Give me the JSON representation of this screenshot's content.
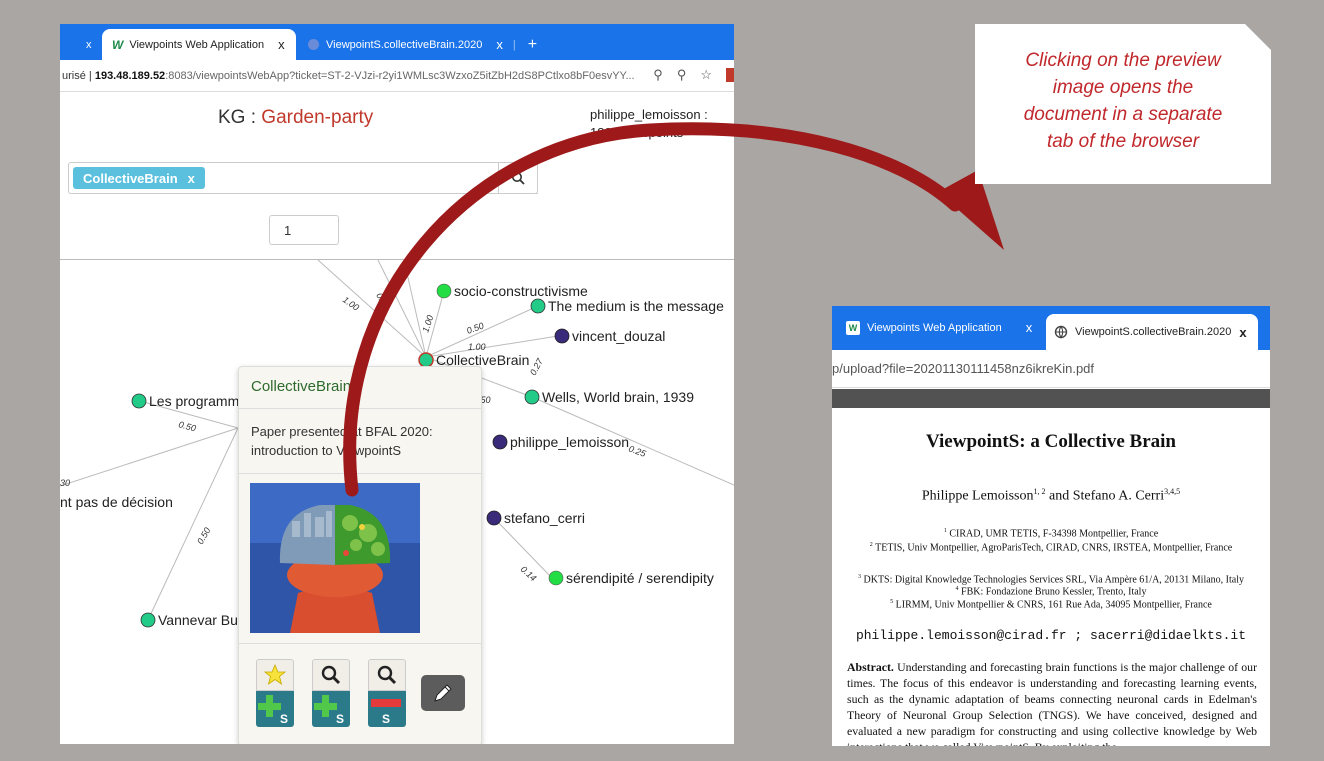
{
  "left_browser": {
    "tabs": [
      {
        "label": "Viewpoints Web Application",
        "close": "x"
      },
      {
        "label": "ViewpointS.collectiveBrain.2020",
        "close": "x"
      }
    ],
    "prev_tab_close": "x",
    "new_tab": "+",
    "address": {
      "prefix": "urisé |",
      "host": "193.48.189.52",
      "path": ":8083/viewpointsWebApp?ticket=ST-2-VJzi-r2yi1WMLsc3WzxoZ5itZbH2dS8PCtlxo8bF0esvYY..."
    },
    "kg_label": "KG :",
    "kg_name": "Garden-party",
    "user_line1": "philippe_lemoisson :",
    "user_line2": "1802 viewpoints",
    "search_tag": "CollectiveBrain",
    "search_tag_remove": "x",
    "page_value": "1"
  },
  "graph": {
    "nodes": [
      {
        "label": "socio-constructivisme",
        "color": "#22dd44"
      },
      {
        "label": "The medium is the message",
        "color": "#22cc88"
      },
      {
        "label": "vincent_douzal",
        "color": "#3a2a7a"
      },
      {
        "label": "CollectiveBrain",
        "color": "#22cc88"
      },
      {
        "label": "Wells, World brain, 1939",
        "color": "#22cc88"
      },
      {
        "label": "philippe_lemoisson",
        "color": "#3a2a7a"
      },
      {
        "label": "stefano_cerri",
        "color": "#3a2a7a"
      },
      {
        "label": "sérendipité / serendipity",
        "color": "#22dd44"
      },
      {
        "label": "Les programm",
        "color": "#22cc88"
      },
      {
        "label": "nt pas de décision",
        "color": ""
      },
      {
        "label": "Vannevar Bu",
        "color": "#22cc88"
      }
    ],
    "edge_labels": [
      "1.00",
      "0.50",
      "1.00",
      "0.50",
      "1.00",
      "0.27",
      ".50",
      "0.25",
      "0.50",
      "0.14",
      "0.50",
      "30"
    ]
  },
  "popup": {
    "title": "CollectiveBrain",
    "desc_line1": "Paper presented at BFAL 2020:",
    "desc_line2": "introduction to ViewpointS",
    "buttons": [
      "add-star",
      "add-zoom",
      "remove-zoom",
      "edit"
    ]
  },
  "callout": {
    "line1": "Clicking on the preview",
    "line2": "image opens the",
    "line3": "document in a separate",
    "line4": "tab of the browser"
  },
  "right_browser": {
    "tab1": "Viewpoints Web Application",
    "tab1_close": "x",
    "tab2": "ViewpointS.collectiveBrain.2020",
    "tab2_close": "x",
    "address": "p/upload?file=20201130111458nz6ikreKin.pdf",
    "pdf": {
      "title": "ViewpointS: a Collective Brain",
      "author1": "Philippe Lemoisson",
      "author1_sup": "1, 2",
      "and": " and ",
      "author2": "Stefano A. Cerri",
      "author2_sup": "3,4,5",
      "aff1": "CIRAD, UMR TETIS, F-34398 Montpellier, France",
      "aff2": "TETIS, Univ Montpellier, AgroParisTech, CIRAD, CNRS, IRSTEA, Montpellier, France",
      "aff3": "DKTS: Digital Knowledge Technologies Services SRL, Via Ampère 61/A, 20131 Milano, Italy",
      "aff4": "FBK: Fondazione Bruno Kessler, Trento, Italy",
      "aff5": "LIRMM, Univ Montpellier & CNRS, 161 Rue Ada, 34095 Montpellier, France",
      "email": "philippe.lemoisson@cirad.fr ; sacerri@didaelkts.it",
      "abstract_label": "Abstract.",
      "abstract_text": "Understanding and forecasting brain functions is the major challenge of our times. The focus of this endeavor is understanding and forecasting learning events, such as the dynamic adaptation of beams connecting neuronal cards in Edelman's Theory of Neuronal Group Selection (TNGS). We have conceived, designed and evaluated a new paradigm for constructing and using collective knowledge by Web interactions that we called ViewpointS. By exploiting the"
    }
  }
}
